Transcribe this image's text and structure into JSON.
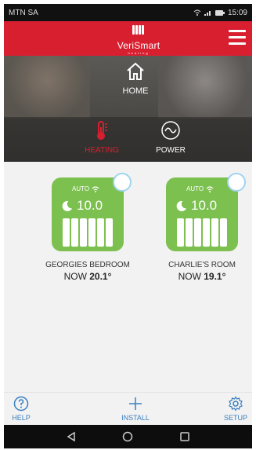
{
  "status_bar": {
    "carrier": "MTN SA",
    "time": "15:09"
  },
  "header": {
    "logo_text": "VeriSmart",
    "logo_sub": "heating",
    "menu_icon": "hamburger-icon"
  },
  "nav": {
    "home_label": "HOME",
    "tabs": [
      {
        "label": "HEATING",
        "icon": "thermometer-icon",
        "active": true
      },
      {
        "label": "POWER",
        "icon": "power-wave-icon",
        "active": false
      }
    ]
  },
  "devices": [
    {
      "mode": "AUTO",
      "set_temp": "10.0",
      "name": "GEORGIES BEDROOM",
      "now_prefix": "NOW",
      "now_temp": "20.1°"
    },
    {
      "mode": "AUTO",
      "set_temp": "10.0",
      "name": "CHARLIE'S ROOM",
      "now_prefix": "NOW",
      "now_temp": "19.1°"
    }
  ],
  "bottom_bar": {
    "help": "HELP",
    "install": "INSTALL",
    "setup": "SETUP"
  },
  "colors": {
    "brand_red": "#d81f30",
    "tile_green": "#7cc04f",
    "link_blue": "#3a7fc0"
  }
}
